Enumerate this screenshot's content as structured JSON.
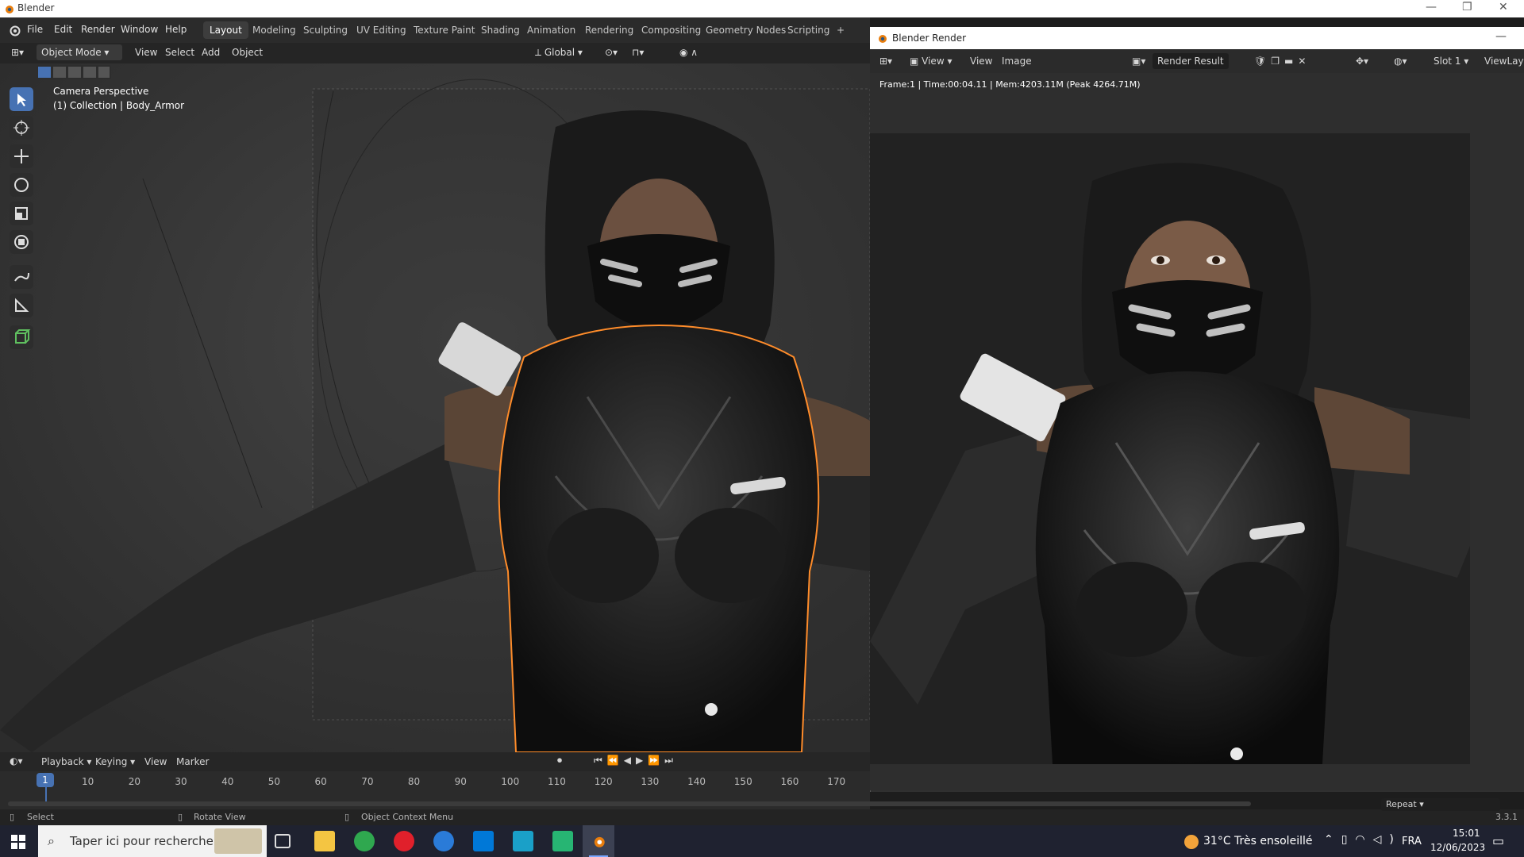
{
  "os_window": {
    "title": "Blender"
  },
  "menu": [
    "File",
    "Edit",
    "Render",
    "Window",
    "Help"
  ],
  "workspaces": [
    "Layout",
    "Modeling",
    "Sculpting",
    "UV Editing",
    "Texture Paint",
    "Shading",
    "Animation",
    "Rendering",
    "Compositing",
    "Geometry Nodes",
    "Scripting",
    "+"
  ],
  "active_workspace": "Layout",
  "viewport_header": {
    "mode": "Object Mode",
    "menus": [
      "View",
      "Select",
      "Add",
      "Object"
    ],
    "transform_orientation": "Global"
  },
  "viewport_overlay": {
    "line1": "Camera Perspective",
    "line2": "(1) Collection | Body_Armor"
  },
  "timeline": {
    "menus": [
      "Playback",
      "Keying",
      "View",
      "Marker"
    ],
    "current_frame": "1",
    "frame_labels": [
      "10",
      "20",
      "30",
      "40",
      "50",
      "60",
      "70",
      "80",
      "90",
      "100",
      "110",
      "120",
      "130",
      "140",
      "150",
      "160",
      "170"
    ]
  },
  "statusbar": {
    "select": "Select",
    "rotate": "Rotate View",
    "context": "Object Context Menu",
    "version": "3.3.1"
  },
  "render_window": {
    "title": "Blender Render",
    "menus": [
      "View",
      "View",
      "Image"
    ],
    "image_name": "Render Result",
    "slot": "Slot 1",
    "view_layer": "ViewLaye",
    "stats": "Frame:1 | Time:00:04.11 | Mem:4203.11M (Peak 4264.71M)",
    "repeat": "Repeat"
  },
  "taskbar": {
    "search_placeholder": "Taper ici pour rechercher",
    "weather": "31°C  Très ensoleillé",
    "lang": "FRA",
    "time": "15:01",
    "date": "12/06/2023"
  }
}
